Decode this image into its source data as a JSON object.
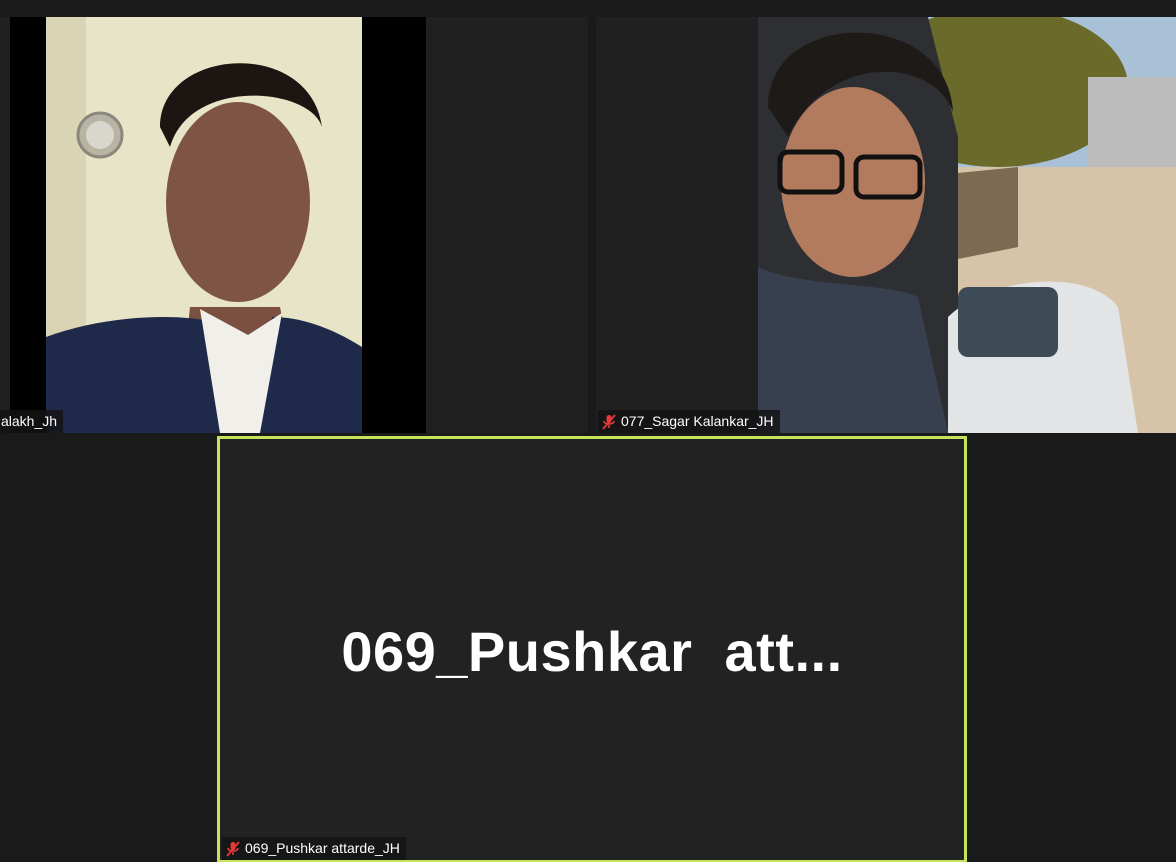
{
  "participants": [
    {
      "name": "alakh_Jh",
      "muted": false,
      "video_on": true,
      "active_speaker": false
    },
    {
      "name": "077_Sagar Kalankar_JH",
      "muted": true,
      "video_on": true,
      "active_speaker": false
    },
    {
      "name": "069_Pushkar attarde_JH",
      "display_name_truncated": "069_Pushkar  att...",
      "muted": true,
      "video_on": false,
      "active_speaker": true
    }
  ],
  "colors": {
    "background": "#1a1a1a",
    "tile_background": "#202020",
    "active_speaker_border": "#c6e35c",
    "muted_icon": "#e5393a"
  },
  "icons": {
    "muted": "microphone-muted-icon"
  }
}
